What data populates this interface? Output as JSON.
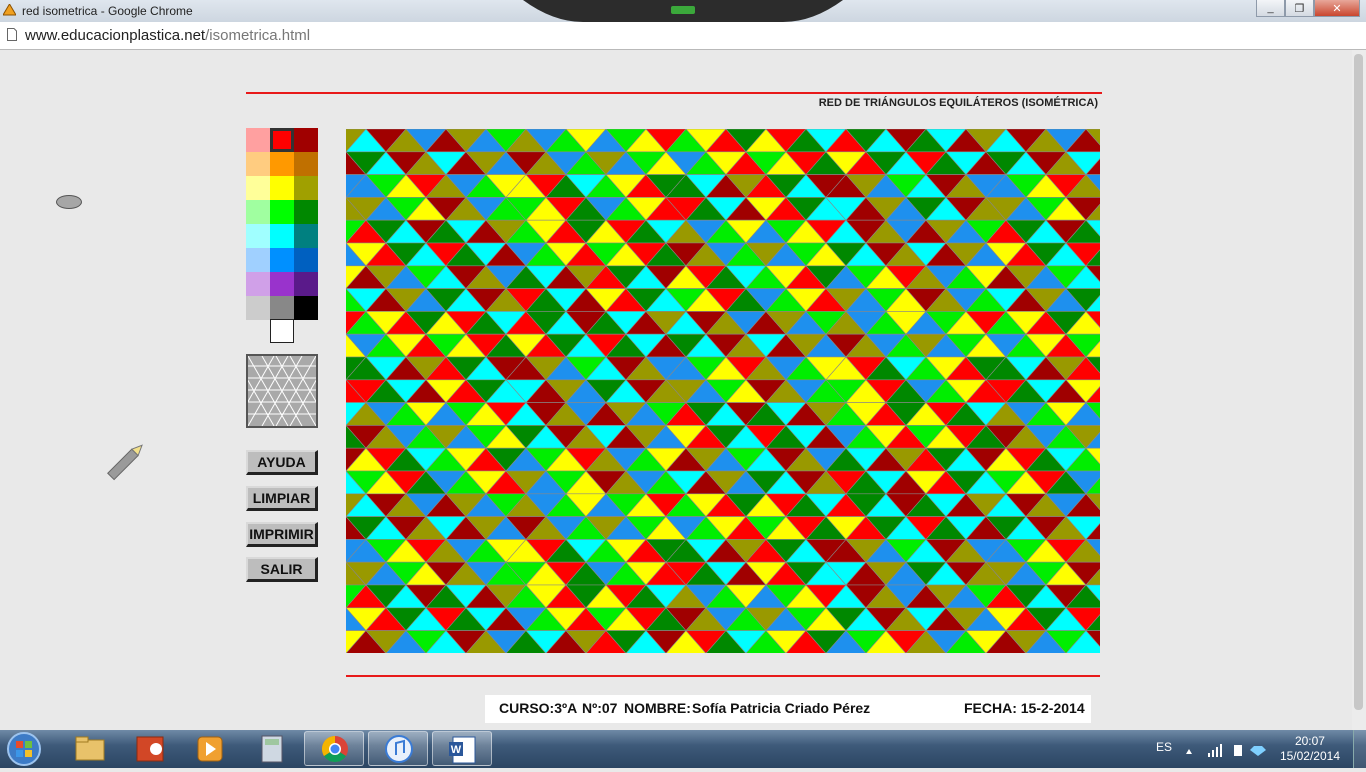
{
  "window": {
    "title": "red isometrica - Google Chrome",
    "url_domain": "www.educacionplastica.net",
    "url_path": "/isometrica.html"
  },
  "page": {
    "heading": "RED DE TRIÁNGULOS EQUILÁTEROS (ISOMÉTRICA)",
    "palette_selected": "#ff0000",
    "palette": [
      [
        "#ffa0a0",
        "#ff0000",
        "#a00000"
      ],
      [
        "#ffcc80",
        "#ff9900",
        "#c07000"
      ],
      [
        "#ffff99",
        "#ffff00",
        "#a0a000"
      ],
      [
        "#a0ffa0",
        "#00ff00",
        "#008800"
      ],
      [
        "#a0ffff",
        "#00ffff",
        "#008080"
      ],
      [
        "#a0d0ff",
        "#0090ff",
        "#0060c0"
      ],
      [
        "#d0a0e8",
        "#9933cc",
        "#5a1a8a"
      ],
      [
        "#cccccc",
        "#888888",
        "#000000"
      ]
    ],
    "extra_swatch": "#ffffff",
    "buttons": {
      "help": "AYUDA",
      "clear": "LIMPIAR",
      "print": "IMPRIMIR",
      "exit": "SALIR"
    },
    "footer": {
      "curso": "CURSO:3ºA",
      "numero": "Nº:07",
      "nombre_label": "NOMBRE:",
      "nombre": "Sofía Patricia Criado Pérez",
      "fecha": "FECHA: 15-2-2014"
    }
  },
  "taskbar": {
    "language": "ES",
    "time": "20:07",
    "date": "15/02/2014",
    "apps": [
      "explorer",
      "powerpoint",
      "media-player",
      "calculator",
      "chrome",
      "itunes",
      "word"
    ]
  }
}
